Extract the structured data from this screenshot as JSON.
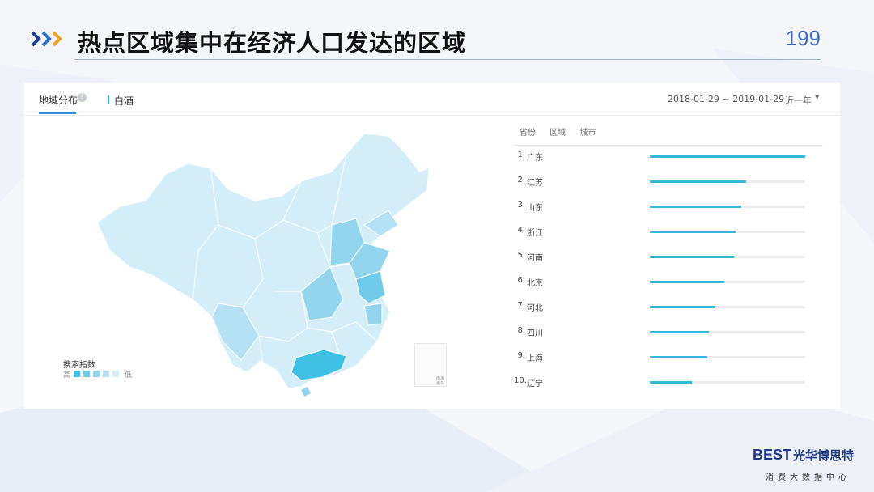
{
  "slide": {
    "title": "热点区域集中在经济人口发达的区域",
    "page_number": "199"
  },
  "panel": {
    "tab_label": "地域分布",
    "help_glyph": "?",
    "keyword": "白酒",
    "date_range": "2018-01-29 ~ 2019-01-29",
    "range_select": "近一年",
    "rank_tabs": [
      "省份",
      "区域",
      "城市"
    ],
    "active_rank_tab": "省份"
  },
  "ranking": [
    {
      "rank": "1.",
      "name": "广东",
      "value": 1.0
    },
    {
      "rank": "2.",
      "name": "江苏",
      "value": 0.62
    },
    {
      "rank": "3.",
      "name": "山东",
      "value": 0.59
    },
    {
      "rank": "4.",
      "name": "浙江",
      "value": 0.55
    },
    {
      "rank": "5.",
      "name": "河南",
      "value": 0.54
    },
    {
      "rank": "6.",
      "name": "北京",
      "value": 0.48
    },
    {
      "rank": "7.",
      "name": "河北",
      "value": 0.42
    },
    {
      "rank": "8.",
      "name": "四川",
      "value": 0.38
    },
    {
      "rank": "9.",
      "name": "上海",
      "value": 0.37
    },
    {
      "rank": "10.",
      "name": "辽宁",
      "value": 0.27
    }
  ],
  "legend": {
    "title": "搜索指数",
    "high": "高",
    "low": "低",
    "colors": [
      "#3fc1e6",
      "#6fcbe9",
      "#93d5ee",
      "#b4e1f3",
      "#d3eef8"
    ]
  },
  "map": {
    "minimap_label": "南海诸岛",
    "base_color": "#d3eef8",
    "mid_color": "#93d5ee",
    "hot_color": "#3fc1e6"
  },
  "logo": {
    "brand": "BEST",
    "name_cn": "光华博思特",
    "subtitle": "消费大数据中心"
  }
}
